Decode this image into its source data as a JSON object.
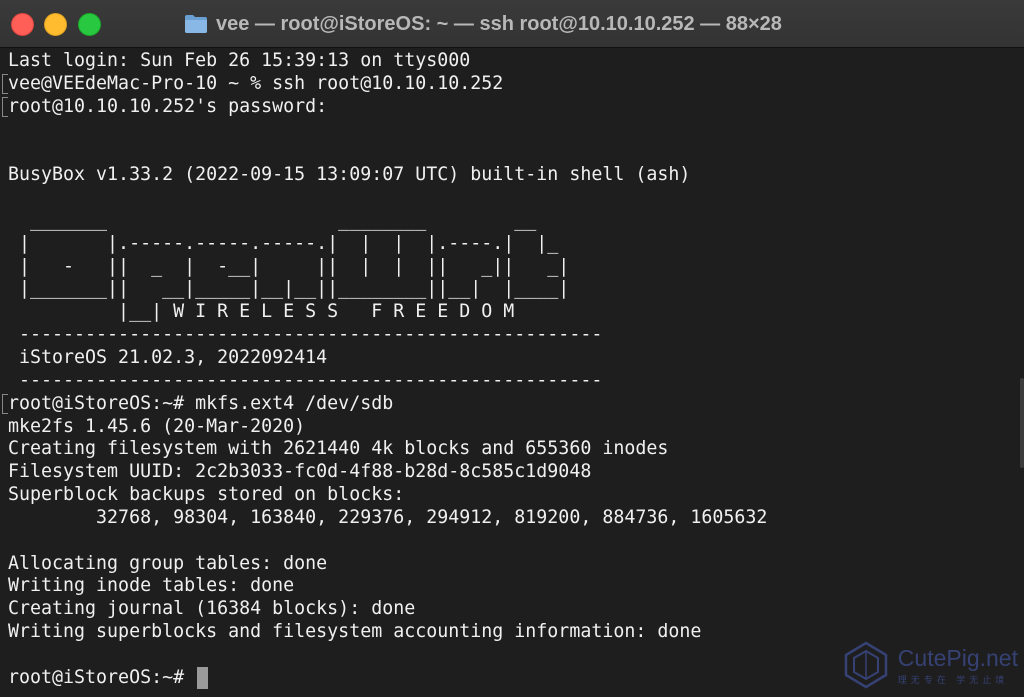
{
  "window": {
    "title": "vee — root@iStoreOS: ~ — ssh root@10.10.10.252 — 88×28",
    "traffic_lights": {
      "close": "#ff5f57",
      "minimize": "#febc2e",
      "zoom": "#28c840"
    }
  },
  "terminal": {
    "lines": [
      "Last login: Sun Feb 26 15:39:13 on ttys000",
      "vee@VEEdeMac-Pro-10 ~ % ssh root@10.10.10.252",
      "root@10.10.10.252's password:",
      "",
      "",
      "BusyBox v1.33.2 (2022-09-15 13:09:07 UTC) built-in shell (ash)",
      "",
      "  _______                     ________        __",
      " |       |.-----.-----.-----.|  |  |  |.----.|  |_",
      " |   -   ||  _  |  -__|     ||  |  |  ||   _||   _|",
      " |_______||   __|_____|__|__||________||__|  |____|",
      "          |__| W I R E L E S S   F R E E D O M",
      " -----------------------------------------------------",
      " iStoreOS 21.02.3, 2022092414",
      " -----------------------------------------------------",
      "root@iStoreOS:~# mkfs.ext4 /dev/sdb",
      "mke2fs 1.45.6 (20-Mar-2020)",
      "Creating filesystem with 2621440 4k blocks and 655360 inodes",
      "Filesystem UUID: 2c2b3033-fc0d-4f88-b28d-8c585c1d9048",
      "Superblock backups stored on blocks:",
      "        32768, 98304, 163840, 229376, 294912, 819200, 884736, 1605632",
      "",
      "Allocating group tables: done",
      "Writing inode tables: done",
      "Creating journal (16384 blocks): done",
      "Writing superblocks and filesystem accounting information: done",
      "",
      "root@iStoreOS:~# "
    ],
    "marked_lines": [
      1,
      2,
      15
    ]
  },
  "watermark": {
    "brand": "CutePig.net",
    "tagline": "理无专在 学无止境"
  },
  "colors": {
    "background": "#1e1e1e",
    "foreground": "#f0f0f0",
    "title_text": "#b8b8b8",
    "cursor": "#9a9a9a",
    "watermark": "#3c4a8a"
  }
}
